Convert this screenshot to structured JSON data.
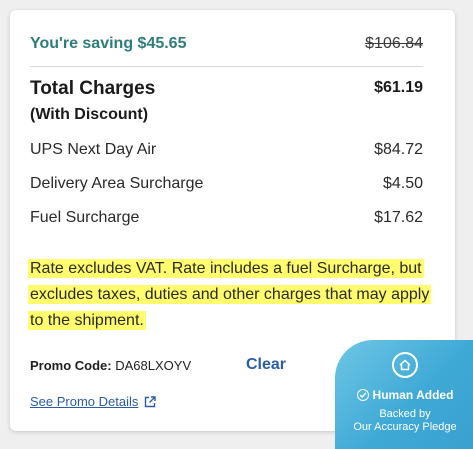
{
  "summary": {
    "saving_text": "You're saving $45.65",
    "original_price": "$106.84",
    "total_title": "Total Charges",
    "total_subtitle": "(With Discount)",
    "total_amount": "$61.19"
  },
  "line_items": [
    {
      "label": "UPS Next Day Air",
      "amount": "$84.72"
    },
    {
      "label": "Delivery Area Surcharge",
      "amount": "$4.50"
    },
    {
      "label": "Fuel Surcharge",
      "amount": "$17.62"
    }
  ],
  "note": {
    "text": "Rate excludes VAT. Rate includes a fuel Surcharge, but excludes taxes, duties and other charges that may apply to the shipment.",
    "highlight_color": "#fffc6e"
  },
  "promo": {
    "label": "Promo Code:",
    "code": "DA68LXOYV",
    "clear_label": "Clear",
    "details_link": "See Promo Details"
  },
  "badge": {
    "title": "Human Added",
    "subtitle_line1": "Backed by",
    "subtitle_line2": "Our Accuracy Pledge",
    "icon": "home-icon",
    "check_icon": "check-circle-icon"
  },
  "colors": {
    "saving_green": "#2e7d7a",
    "link_blue": "#2a5ca8",
    "badge_blue": "#3fa9d6"
  }
}
